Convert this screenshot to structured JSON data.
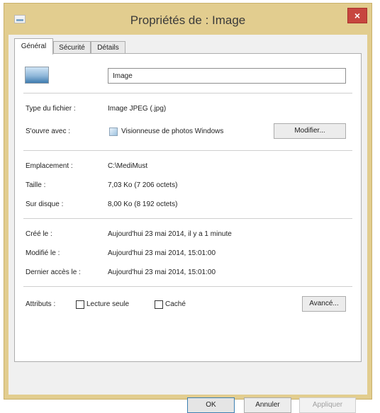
{
  "window": {
    "title": "Propriétés de : Image",
    "close_glyph": "×"
  },
  "tabs": [
    {
      "label": "Général",
      "active": true
    },
    {
      "label": "Sécurité",
      "active": false
    },
    {
      "label": "Détails",
      "active": false
    }
  ],
  "file": {
    "name": "Image"
  },
  "fields": {
    "type_label": "Type du fichier :",
    "type_value": "Image JPEG (.jpg)",
    "opens_label": "S'ouvre avec :",
    "opens_value": "Visionneuse de photos Windows",
    "change_button": "Modifier...",
    "location_label": "Emplacement :",
    "location_value": "C:\\MediMust",
    "size_label": "Taille :",
    "size_value": "7,03 Ko (7 206 octets)",
    "disk_label": "Sur disque :",
    "disk_value": "8,00 Ko (8 192 octets)",
    "created_label": "Créé le :",
    "created_value": "Aujourd'hui 23 mai 2014, il y a 1 minute",
    "modified_label": "Modifié le :",
    "modified_value": "Aujourd'hui 23 mai 2014, 15:01:00",
    "accessed_label": "Dernier accès le :",
    "accessed_value": "Aujourd'hui 23 mai 2014, 15:01:00"
  },
  "attributes": {
    "label": "Attributs :",
    "readonly_label": "Lecture seule",
    "readonly_checked": false,
    "hidden_label": "Caché",
    "hidden_checked": false,
    "advanced_button": "Avancé..."
  },
  "footer": {
    "ok": "OK",
    "cancel": "Annuler",
    "apply": "Appliquer"
  },
  "colors": {
    "frame": "#e2cd8f",
    "close": "#c7463f",
    "focus_border": "#3c7fb1"
  }
}
